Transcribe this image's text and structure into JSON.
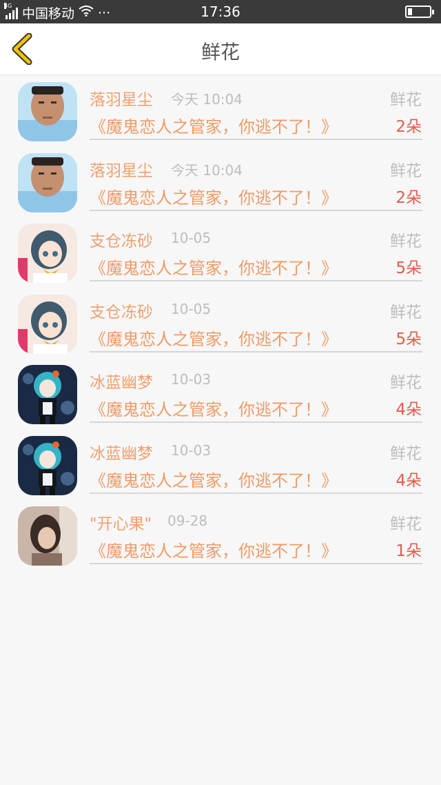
{
  "status_bar": {
    "network": "4G",
    "carrier": "中国移动",
    "dots": "···",
    "time": "17:36"
  },
  "header": {
    "title": "鲜花"
  },
  "items": [
    {
      "name": "落羽星尘",
      "date": "今天 10:04",
      "gift": "鲜花",
      "book": "《魔鬼恋人之管家，你逃不了！》",
      "count": "2朵",
      "avatar": "photo-boy"
    },
    {
      "name": "落羽星尘",
      "date": "今天 10:04",
      "gift": "鲜花",
      "book": "《魔鬼恋人之管家，你逃不了！》",
      "count": "2朵",
      "avatar": "photo-boy"
    },
    {
      "name": "支仓冻砂",
      "date": "10-05",
      "gift": "鲜花",
      "book": "《魔鬼恋人之管家，你逃不了！》",
      "count": "5朵",
      "avatar": "anime-girl-pink"
    },
    {
      "name": "支仓冻砂",
      "date": "10-05",
      "gift": "鲜花",
      "book": "《魔鬼恋人之管家，你逃不了！》",
      "count": "5朵",
      "avatar": "anime-girl-pink"
    },
    {
      "name": "冰蓝幽梦",
      "date": "10-03",
      "gift": "鲜花",
      "book": "《魔鬼恋人之管家，你逃不了！》",
      "count": "4朵",
      "avatar": "anime-girl-dark"
    },
    {
      "name": "冰蓝幽梦",
      "date": "10-03",
      "gift": "鲜花",
      "book": "《魔鬼恋人之管家，你逃不了！》",
      "count": "4朵",
      "avatar": "anime-girl-dark"
    },
    {
      "name": "\"开心果\"",
      "date": "09-28",
      "gift": "鲜花",
      "book": "《魔鬼恋人之管家，你逃不了！》",
      "count": "1朵",
      "avatar": "photo-girl"
    }
  ],
  "colors": {
    "accent": "#f0a070",
    "count": "#e35b4a",
    "back_arrow": "#f2c200"
  }
}
